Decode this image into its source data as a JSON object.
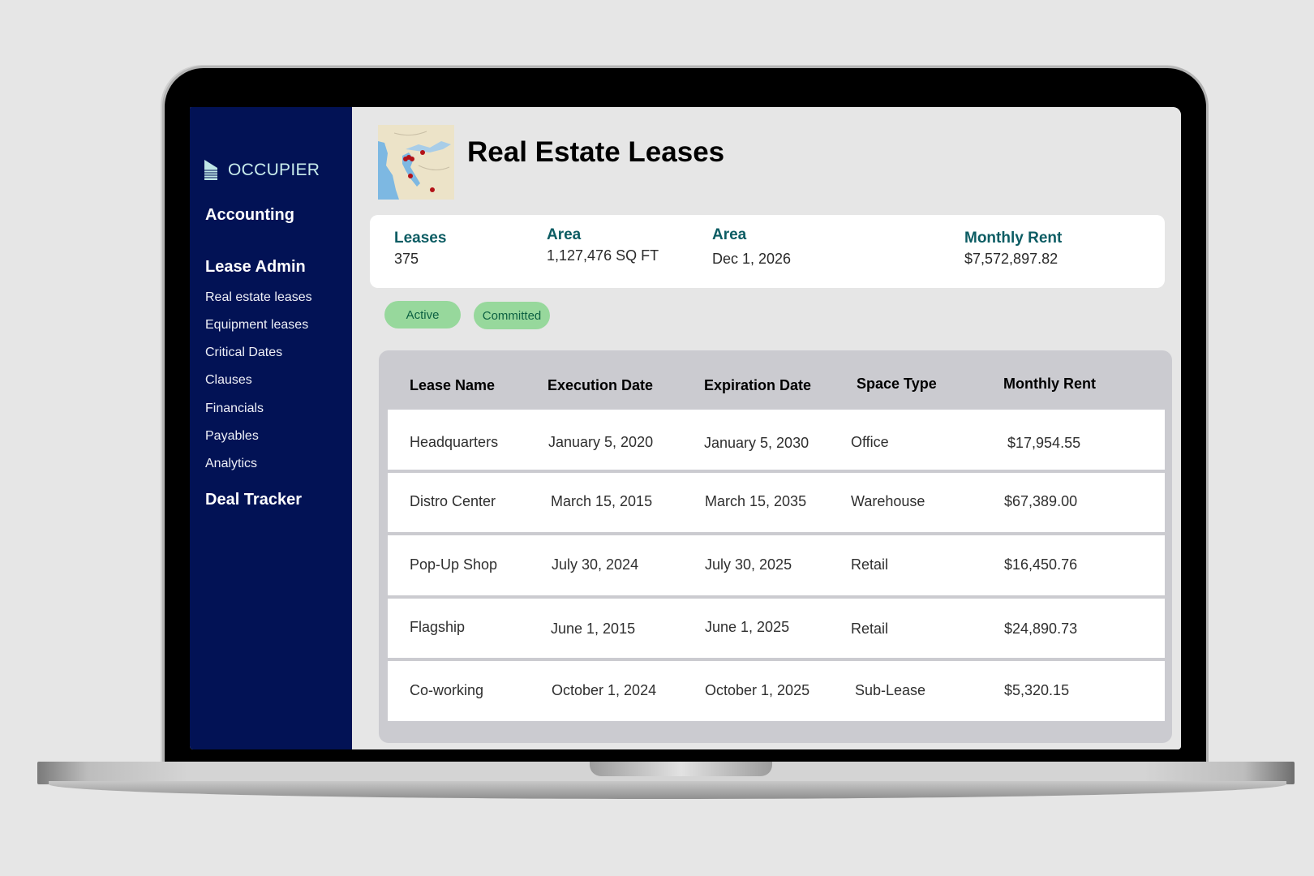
{
  "app": {
    "brand": "OCCUPIER",
    "page_title": "Real Estate Leases",
    "accent_color": "#0c5c63",
    "sidebar_color": "#021255"
  },
  "sidebar": {
    "sections": [
      {
        "label": "Accounting"
      },
      {
        "label": "Lease Admin",
        "items": [
          {
            "label": "Real estate leases"
          },
          {
            "label": "Equipment leases"
          },
          {
            "label": "Critical Dates"
          },
          {
            "label": "Clauses"
          },
          {
            "label": "Financials"
          },
          {
            "label": "Payables"
          },
          {
            "label": "Analytics"
          }
        ]
      },
      {
        "label": "Deal Tracker"
      }
    ]
  },
  "summary": {
    "stats": [
      {
        "label": "Leases",
        "value": "375"
      },
      {
        "label": "Area",
        "value": "1,127,476 SQ FT"
      },
      {
        "label": "Area",
        "value": "Dec 1, 2026"
      },
      {
        "label": "Monthly Rent",
        "value": "$7,572,897.82"
      }
    ]
  },
  "filters": [
    {
      "label": "Active"
    },
    {
      "label": "Committed"
    }
  ],
  "table": {
    "columns": [
      "Lease Name",
      "Execution Date",
      "Expiration Date",
      "Space Type",
      "Monthly Rent"
    ],
    "rows": [
      [
        "Headquarters",
        "January 5, 2020",
        "January 5, 2030",
        "Office",
        "$17,954.55"
      ],
      [
        "Distro Center",
        "March 15, 2015",
        "March 15, 2035",
        "Warehouse",
        "$67,389.00"
      ],
      [
        "Pop-Up Shop",
        "July 30, 2024",
        "July 30, 2025",
        "Retail",
        "$16,450.76"
      ],
      [
        "Flagship",
        "June 1, 2015",
        "June 1, 2025",
        "Retail",
        "$24,890.73"
      ],
      [
        "Co-working",
        "October 1, 2024",
        "October 1, 2025",
        "Sub-Lease",
        "$5,320.15"
      ]
    ]
  },
  "icons": {
    "logo": "building-logo-icon",
    "map": "map-thumbnail-with-location-pins"
  }
}
